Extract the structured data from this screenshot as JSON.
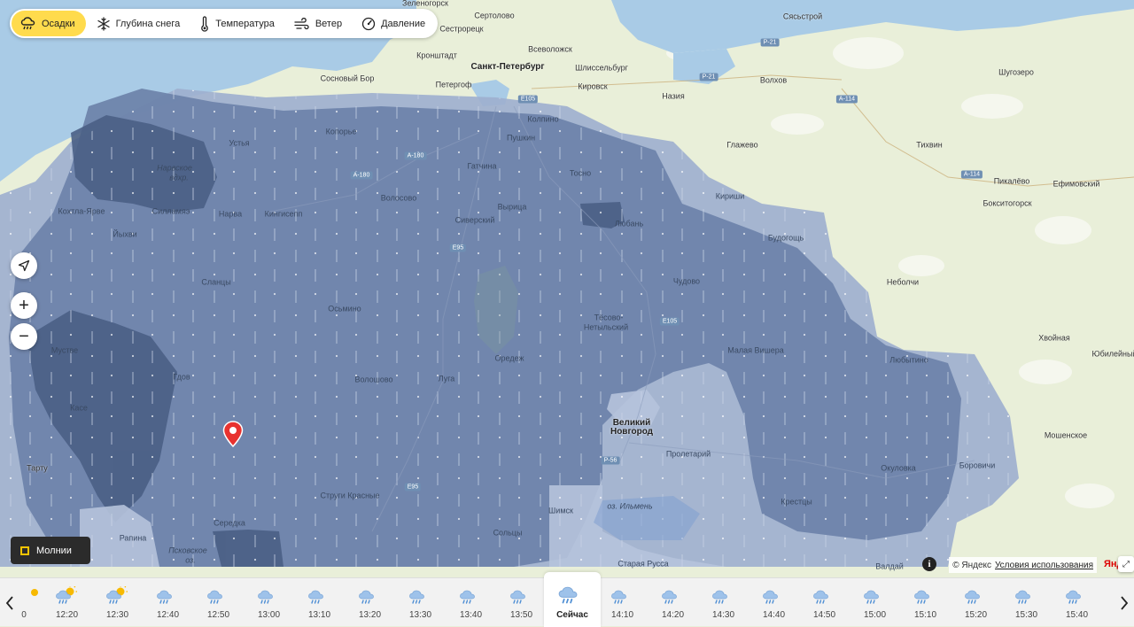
{
  "layers": [
    {
      "label": "Осадки",
      "icon": "rain-cloud-icon",
      "active": true
    },
    {
      "label": "Глубина снега",
      "icon": "snowflake-icon",
      "active": false
    },
    {
      "label": "Температура",
      "icon": "thermometer-icon",
      "active": false
    },
    {
      "label": "Ветер",
      "icon": "wind-icon",
      "active": false
    },
    {
      "label": "Давление",
      "icon": "pressure-gauge-icon",
      "active": false
    }
  ],
  "map": {
    "cities": [
      "Зеленогорск",
      "Сертолово",
      "Сясьстрой",
      "Сестрорецк",
      "Всеволожск",
      "Кронштадт",
      "Санкт-Петербург",
      "Шлиссельбург",
      "Сосновый Бор",
      "Петергоф",
      "Кировск",
      "Назия",
      "Волхов",
      "Шугозеро",
      "Колпино",
      "Пушкин",
      "Устья",
      "Копорье",
      "Глажево",
      "Тихвин",
      "Гатчина",
      "Тосно",
      "Нарвское вдхр.",
      "Кириши",
      "Пикалёво",
      "Ефимовский",
      "Бокситогорск",
      "Кохтла-Ярве",
      "Силламяэ",
      "Нарва",
      "Кингисепп",
      "Волосово",
      "Сиверский",
      "Вырица",
      "Любань",
      "Будогощь",
      "Йыхви",
      "Чудово",
      "Небoлчи",
      "Сланцы",
      "Осьмино",
      "Тёсово-Нетыльский",
      "Мустве",
      "Оредеж",
      "Малая Вишера",
      "Хвойная",
      "Юбилейный",
      "Любытино",
      "Гдов",
      "Волошово",
      "Луга",
      "Великий Новгород",
      "Касе",
      "Мошенское",
      "Пролетарий",
      "Тарту",
      "Окуловка",
      "Боровичи",
      "Струги Красные",
      "Шимск",
      "Крестцы",
      "оз. Ильмень",
      "Сольцы",
      "Середка",
      "Рапина",
      "Псковское оз.",
      "Старая Русса",
      "Валдай"
    ],
    "roads": [
      "Р-21",
      "А-114",
      "Е105",
      "А-180",
      "Е95",
      "Р-56",
      "А-114",
      "Е105"
    ],
    "marker": "location-pin-icon"
  },
  "controls": {
    "locate": "navigate-arrow-icon",
    "zoom_in": "+",
    "zoom_out": "−",
    "lightning_label": "Молнии"
  },
  "attribution": {
    "copyright": "© Яндекс",
    "terms": "Условия использования",
    "brand": "Янд"
  },
  "timeline": {
    "first_partial": "0",
    "slots": [
      {
        "time": "12:20",
        "icon": "sun-cloud-rain-icon"
      },
      {
        "time": "12:30",
        "icon": "sun-cloud-rain-icon"
      },
      {
        "time": "12:40",
        "icon": "cloud-rain-icon"
      },
      {
        "time": "12:50",
        "icon": "cloud-rain-icon"
      },
      {
        "time": "13:00",
        "icon": "cloud-rain-icon"
      },
      {
        "time": "13:10",
        "icon": "cloud-rain-icon"
      },
      {
        "time": "13:20",
        "icon": "cloud-rain-icon"
      },
      {
        "time": "13:30",
        "icon": "cloud-rain-icon"
      },
      {
        "time": "13:40",
        "icon": "cloud-rain-icon"
      },
      {
        "time": "13:50",
        "icon": "cloud-rain-icon"
      },
      {
        "time": "Сейчас",
        "icon": "cloud-rain-icon",
        "current": true
      },
      {
        "time": "14:10",
        "icon": "cloud-rain-icon"
      },
      {
        "time": "14:20",
        "icon": "cloud-rain-icon"
      },
      {
        "time": "14:30",
        "icon": "cloud-rain-icon"
      },
      {
        "time": "14:40",
        "icon": "cloud-rain-icon"
      },
      {
        "time": "14:50",
        "icon": "cloud-rain-icon"
      },
      {
        "time": "15:00",
        "icon": "cloud-rain-icon"
      },
      {
        "time": "15:10",
        "icon": "cloud-rain-icon"
      },
      {
        "time": "15:20",
        "icon": "cloud-rain-icon"
      },
      {
        "time": "15:30",
        "icon": "cloud-rain-icon"
      },
      {
        "time": "15:40",
        "icon": "cloud-rain-icon"
      }
    ]
  },
  "colors": {
    "active_tab": "#ffdb4d",
    "rain_light": "#9eb0cf",
    "rain_medium": "#6e84ab",
    "rain_heavy": "#4a5f85",
    "marker": "#e8322f",
    "water": "#a9cbe6",
    "land": "#e9efd9"
  }
}
